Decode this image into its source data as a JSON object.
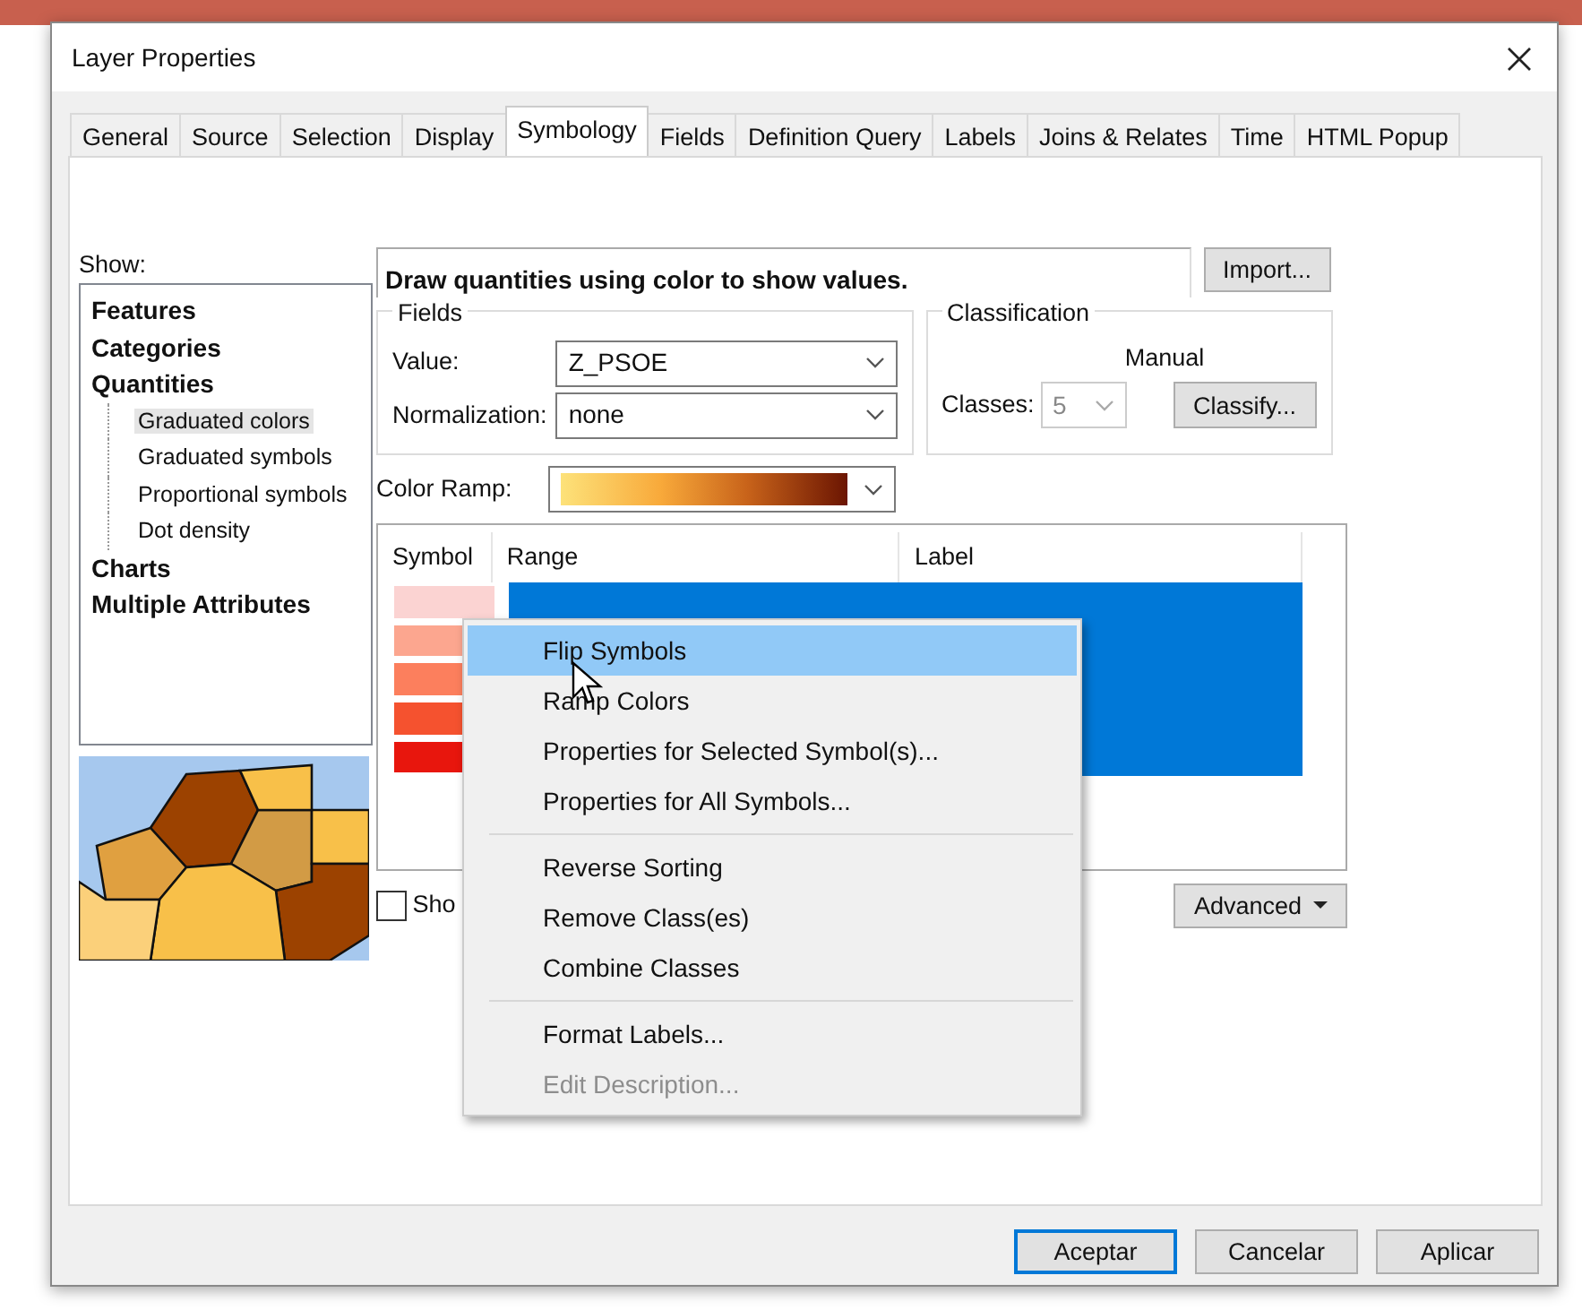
{
  "window": {
    "title": "Layer Properties"
  },
  "tabs": [
    {
      "label": "General",
      "selected": false
    },
    {
      "label": "Source",
      "selected": false
    },
    {
      "label": "Selection",
      "selected": false
    },
    {
      "label": "Display",
      "selected": false
    },
    {
      "label": "Symbology",
      "selected": true
    },
    {
      "label": "Fields",
      "selected": false
    },
    {
      "label": "Definition Query",
      "selected": false
    },
    {
      "label": "Labels",
      "selected": false
    },
    {
      "label": "Joins & Relates",
      "selected": false
    },
    {
      "label": "Time",
      "selected": false
    },
    {
      "label": "HTML Popup",
      "selected": false
    }
  ],
  "show": {
    "label": "Show:",
    "tree": [
      {
        "label": "Features",
        "selected": false
      },
      {
        "label": "Categories",
        "selected": false
      },
      {
        "label": "Quantities",
        "selected": false,
        "children": [
          {
            "label": "Graduated colors",
            "selected": true
          },
          {
            "label": "Graduated symbols",
            "selected": false
          },
          {
            "label": "Proportional symbols",
            "selected": false
          },
          {
            "label": "Dot density",
            "selected": false
          }
        ]
      },
      {
        "label": "Charts",
        "selected": false
      },
      {
        "label": "Multiple Attributes",
        "selected": false
      }
    ]
  },
  "description": "Draw quantities using color to show values.",
  "import_button": "Import...",
  "fields": {
    "title": "Fields",
    "value_label": "Value:",
    "value": "Z_PSOE",
    "normalization_label": "Normalization:",
    "normalization": "none"
  },
  "classification": {
    "title": "Classification",
    "method": "Manual",
    "classes_label": "Classes:",
    "classes": "5",
    "classes_disabled": true,
    "classify_button": "Classify..."
  },
  "color_ramp_label": "Color Ramp:",
  "table": {
    "columns": [
      "Symbol",
      "Range",
      "Label"
    ],
    "rows": [
      {
        "color": "#fbd3d2",
        "selected": true
      },
      {
        "color": "#fca68f",
        "selected": true
      },
      {
        "color": "#fc7f5d",
        "selected": true
      },
      {
        "color": "#f5522f",
        "selected": true
      },
      {
        "color": "#e8160d",
        "selected": true
      }
    ]
  },
  "show_checkbox": {
    "label": "Sho",
    "checked": false
  },
  "advanced_button": "Advanced",
  "context_menu": [
    {
      "kind": "item",
      "label": "Flip Symbols",
      "selected": true,
      "disabled": false
    },
    {
      "kind": "item",
      "label": "Ramp Colors",
      "selected": false,
      "disabled": false
    },
    {
      "kind": "item",
      "label": "Properties for Selected Symbol(s)...",
      "selected": false,
      "disabled": false
    },
    {
      "kind": "item",
      "label": "Properties for All Symbols...",
      "selected": false,
      "disabled": false
    },
    {
      "kind": "separator"
    },
    {
      "kind": "item",
      "label": "Reverse Sorting",
      "selected": false,
      "disabled": false
    },
    {
      "kind": "item",
      "label": "Remove Class(es)",
      "selected": false,
      "disabled": false
    },
    {
      "kind": "item",
      "label": "Combine Classes",
      "selected": false,
      "disabled": false
    },
    {
      "kind": "separator"
    },
    {
      "kind": "item",
      "label": "Format Labels...",
      "selected": false,
      "disabled": false
    },
    {
      "kind": "item",
      "label": "Edit Description...",
      "selected": false,
      "disabled": true
    }
  ],
  "buttons": [
    {
      "label": "Aceptar",
      "default": true
    },
    {
      "label": "Cancelar",
      "default": false
    },
    {
      "label": "Aplicar",
      "default": false
    }
  ]
}
